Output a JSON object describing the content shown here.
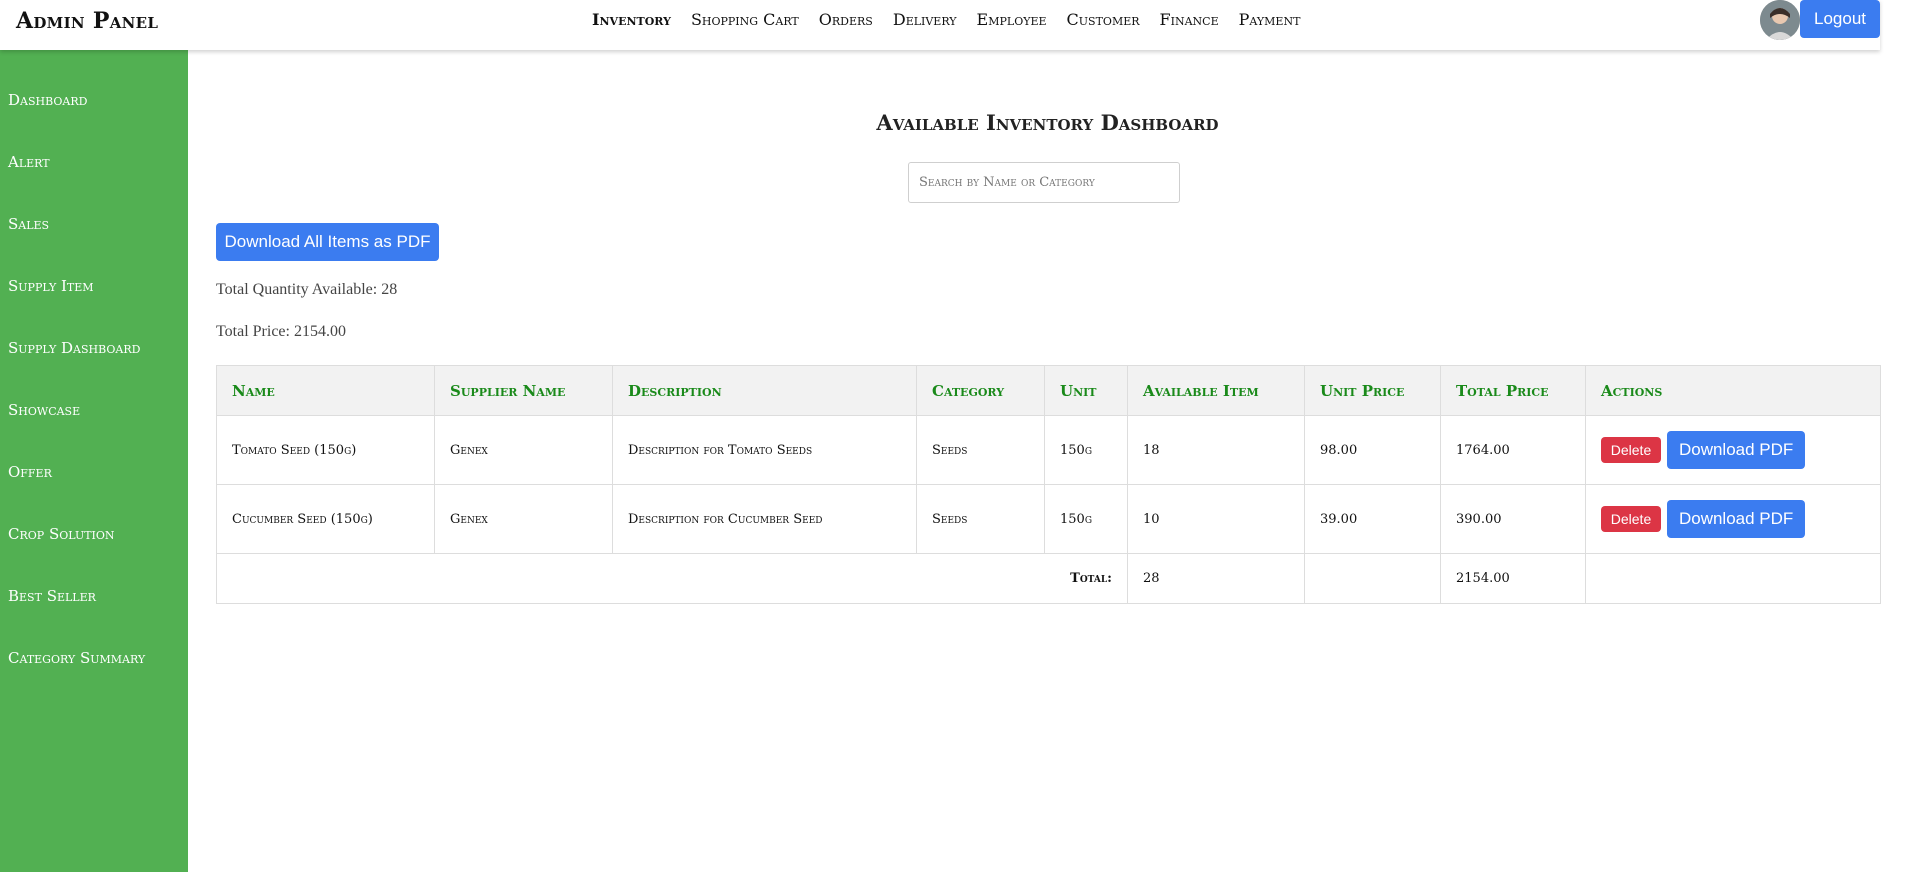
{
  "header": {
    "brand": "Admin Panel",
    "nav": [
      "Inventory",
      "Shopping Cart",
      "Orders",
      "Delivery",
      "Employee",
      "Customer",
      "Finance",
      "Payment"
    ],
    "logout_label": "Logout"
  },
  "sidebar": {
    "items": [
      "Dashboard",
      "Alert",
      "Sales",
      "Supply Item",
      "Supply Dashboard",
      "Showcase",
      "Offer",
      "Crop Solution",
      "Best Seller",
      "Category Summary"
    ]
  },
  "main": {
    "title": "Available Inventory Dashboard",
    "search_placeholder": "Search by Name or Category",
    "download_all_label": "Download All Items as PDF",
    "total_quantity": "Total Quantity Available: 28",
    "total_price": "Total Price: 2154.00"
  },
  "table": {
    "headers": [
      "Name",
      "Supplier Name",
      "Description",
      "Category",
      "Unit",
      "Available Item",
      "Unit Price",
      "Total Price",
      "Actions"
    ],
    "rows": [
      {
        "name": "Tomato Seed (150g)",
        "supplier": "Genex",
        "description": "Description for Tomato Seeds",
        "category": "Seeds",
        "unit": "150g",
        "available": "18",
        "unit_price": "98.00",
        "total_price": "1764.00"
      },
      {
        "name": "Cucumber Seed (150g)",
        "supplier": "Genex",
        "description": "Description for Cucumber Seed",
        "category": "Seeds",
        "unit": "150g",
        "available": "10",
        "unit_price": "39.00",
        "total_price": "390.00"
      }
    ],
    "delete_label": "Delete",
    "download_label": "Download PDF",
    "total_label": "Total:",
    "total_available": "28",
    "total_price": "2154.00"
  },
  "colors": {
    "sidebar_bg": "#52b052",
    "primary_button": "#3b7cf0",
    "delete_button": "#dc3545",
    "header_text_green": "#1a8a1a"
  }
}
